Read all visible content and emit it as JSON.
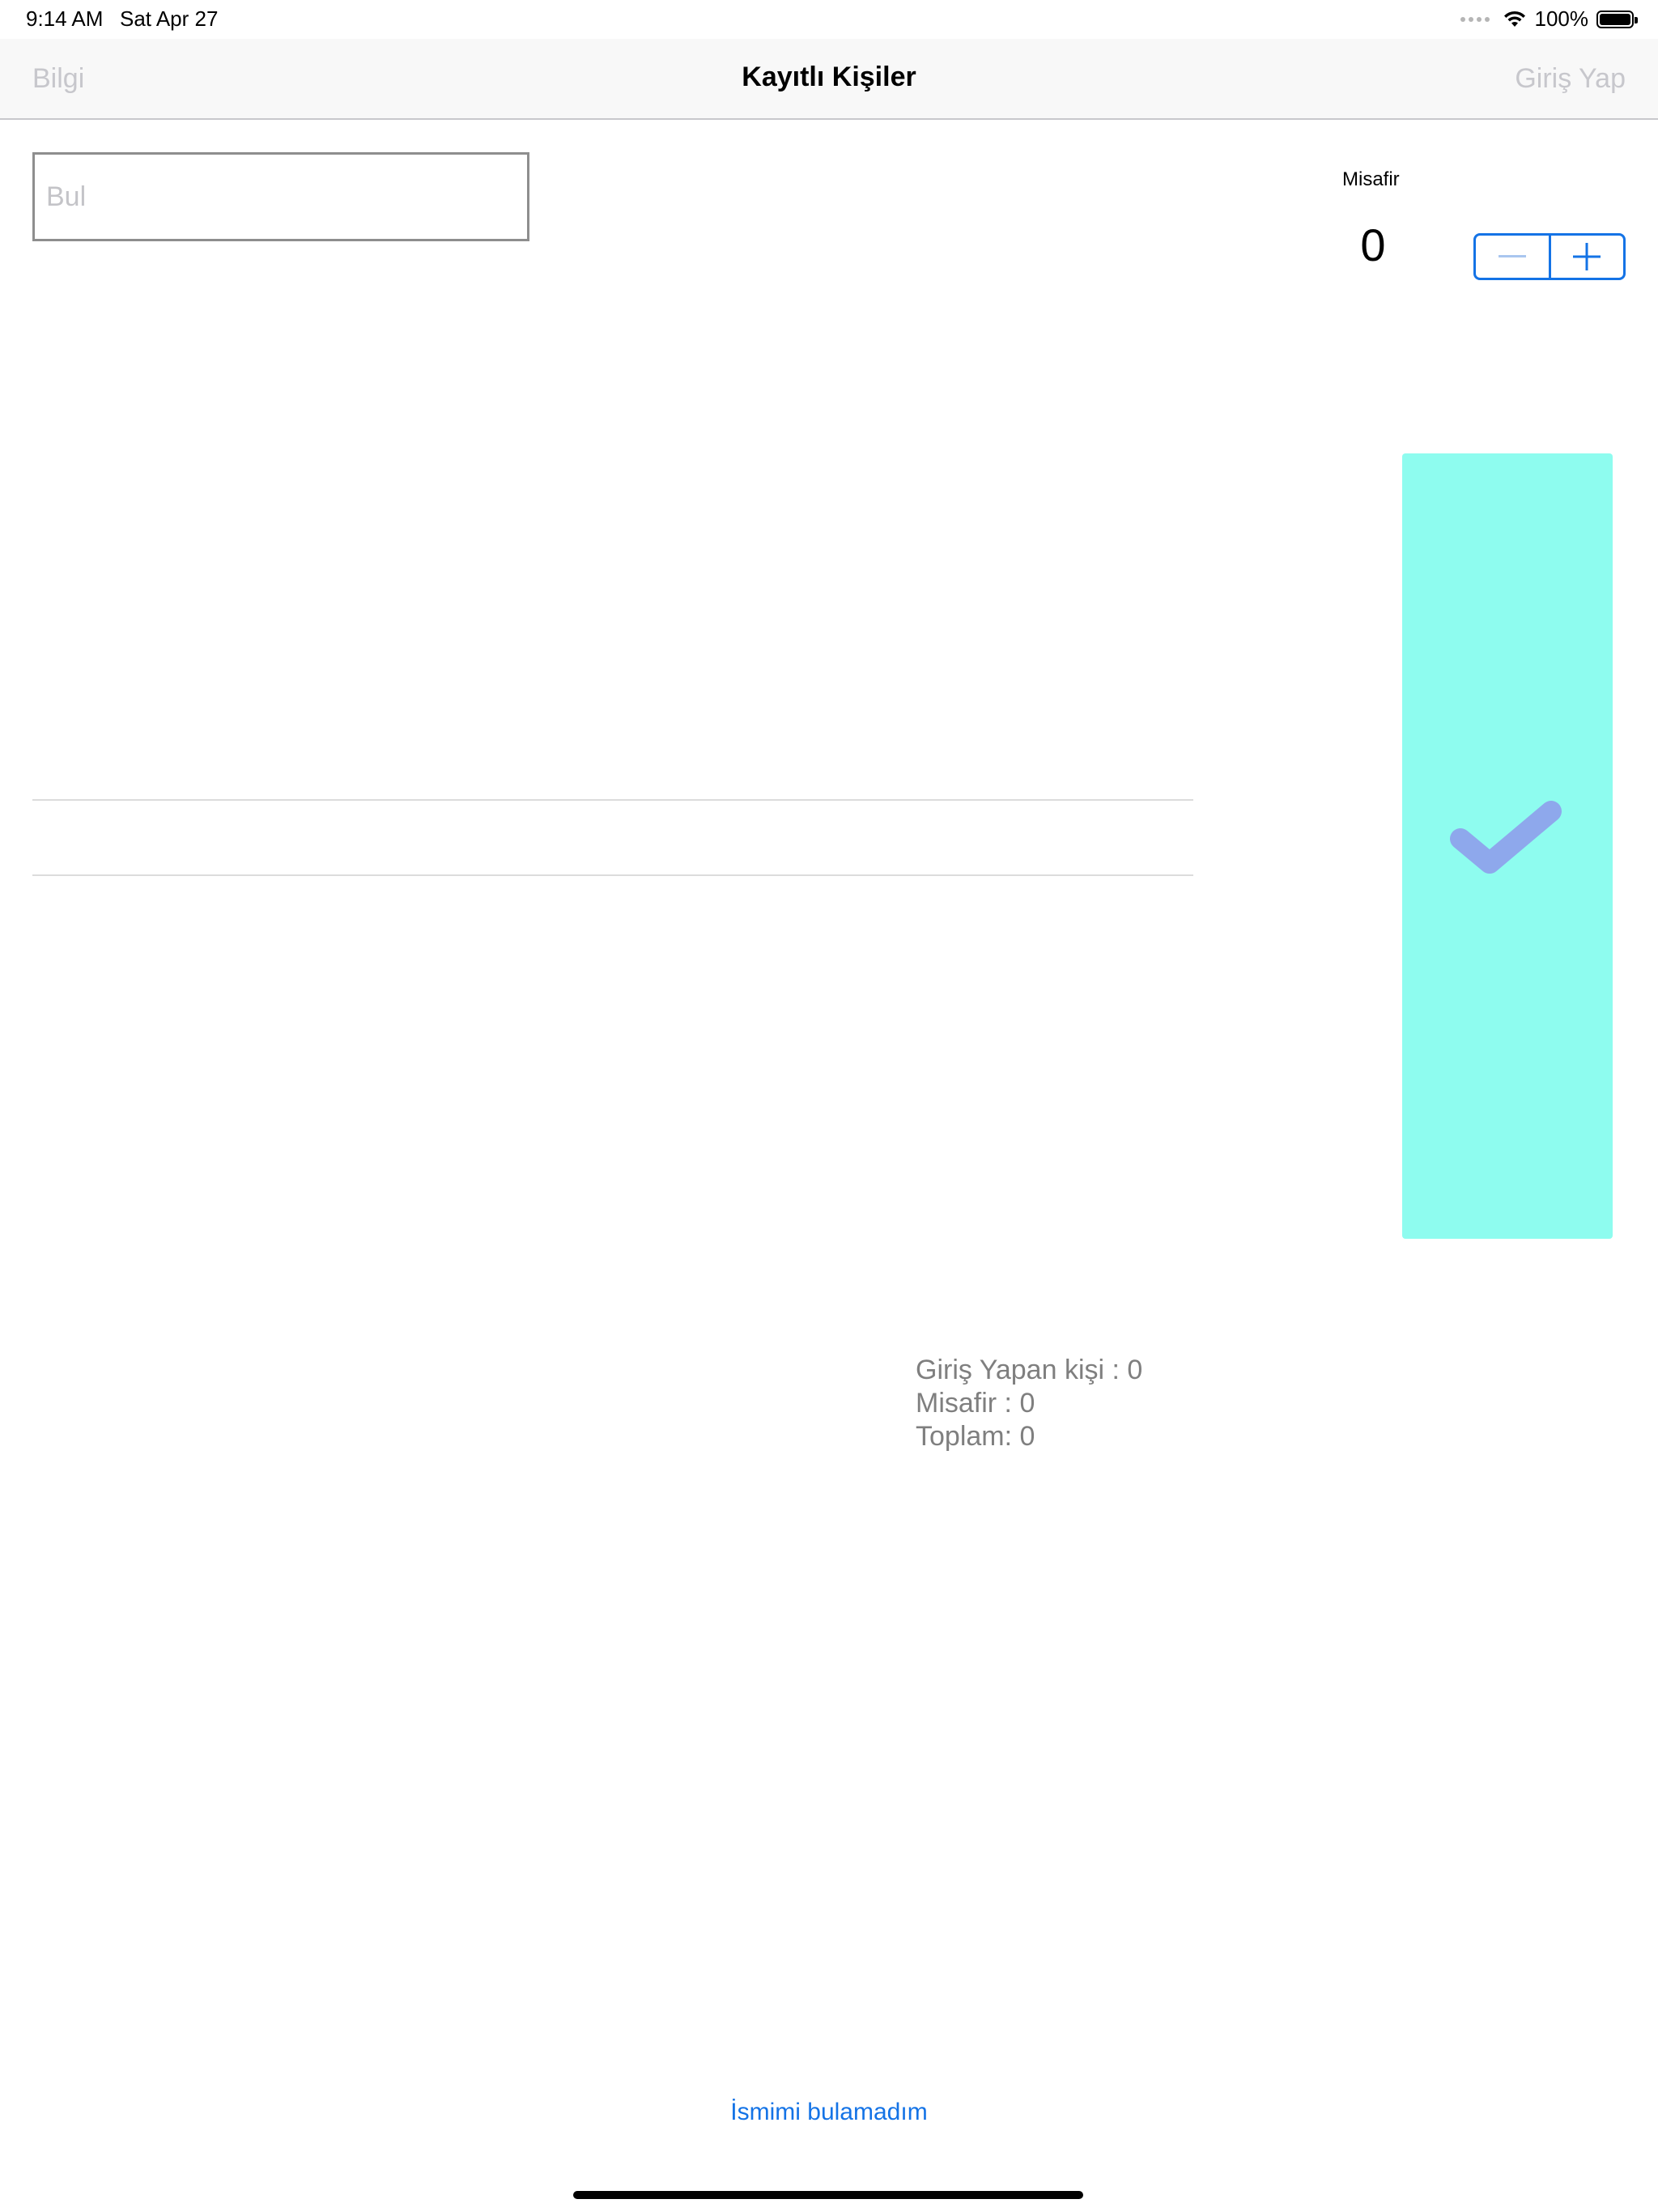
{
  "status_bar": {
    "time": "9:14 AM",
    "date": "Sat Apr 27",
    "battery": "100%"
  },
  "nav": {
    "left_button": "Bilgi",
    "title": "Kayıtlı Kişiler",
    "right_button": "Giriş Yap"
  },
  "search": {
    "placeholder": "Bul",
    "value": ""
  },
  "guests": {
    "label": "Misafir",
    "count": "0",
    "minus": "−",
    "plus": "+"
  },
  "confirm": {
    "icon": "checkmark-icon",
    "background": "#8efcef",
    "check_color": "#8ea8ec"
  },
  "summary": {
    "checked_in": "Giriş Yapan kişi : 0",
    "guests": "Misafir : 0",
    "total": "Toplam:  0"
  },
  "footer": {
    "link": "İsmimi bulamadım"
  },
  "colors": {
    "accent": "#1473e6",
    "nav_disabled": "#c7c7cc",
    "summary_text": "#7f7f7f"
  }
}
